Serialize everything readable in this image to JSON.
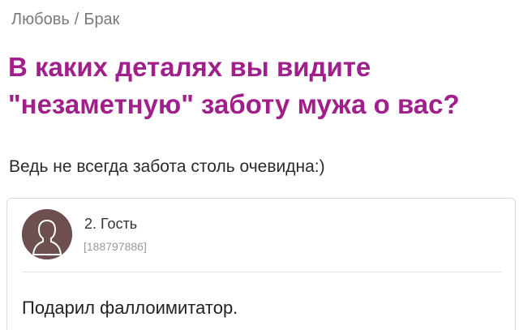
{
  "breadcrumb": {
    "items": [
      "Любовь",
      "Брак"
    ],
    "separator": "/"
  },
  "topic": {
    "title": "В каких деталях вы видите \"незаметную\" заботу мужа о вас?",
    "body": "Ведь не всегда забота столь очевидна:)"
  },
  "comment": {
    "author": "2. Гость",
    "author_id": "[188797886]",
    "avatar_icon": "user-silhouette-icon",
    "text": "Подарил фаллоимитатор."
  },
  "colors": {
    "title": "#a11f8a",
    "breadcrumb": "#7a7a7a",
    "avatar_bg": "#6d4f4f"
  }
}
